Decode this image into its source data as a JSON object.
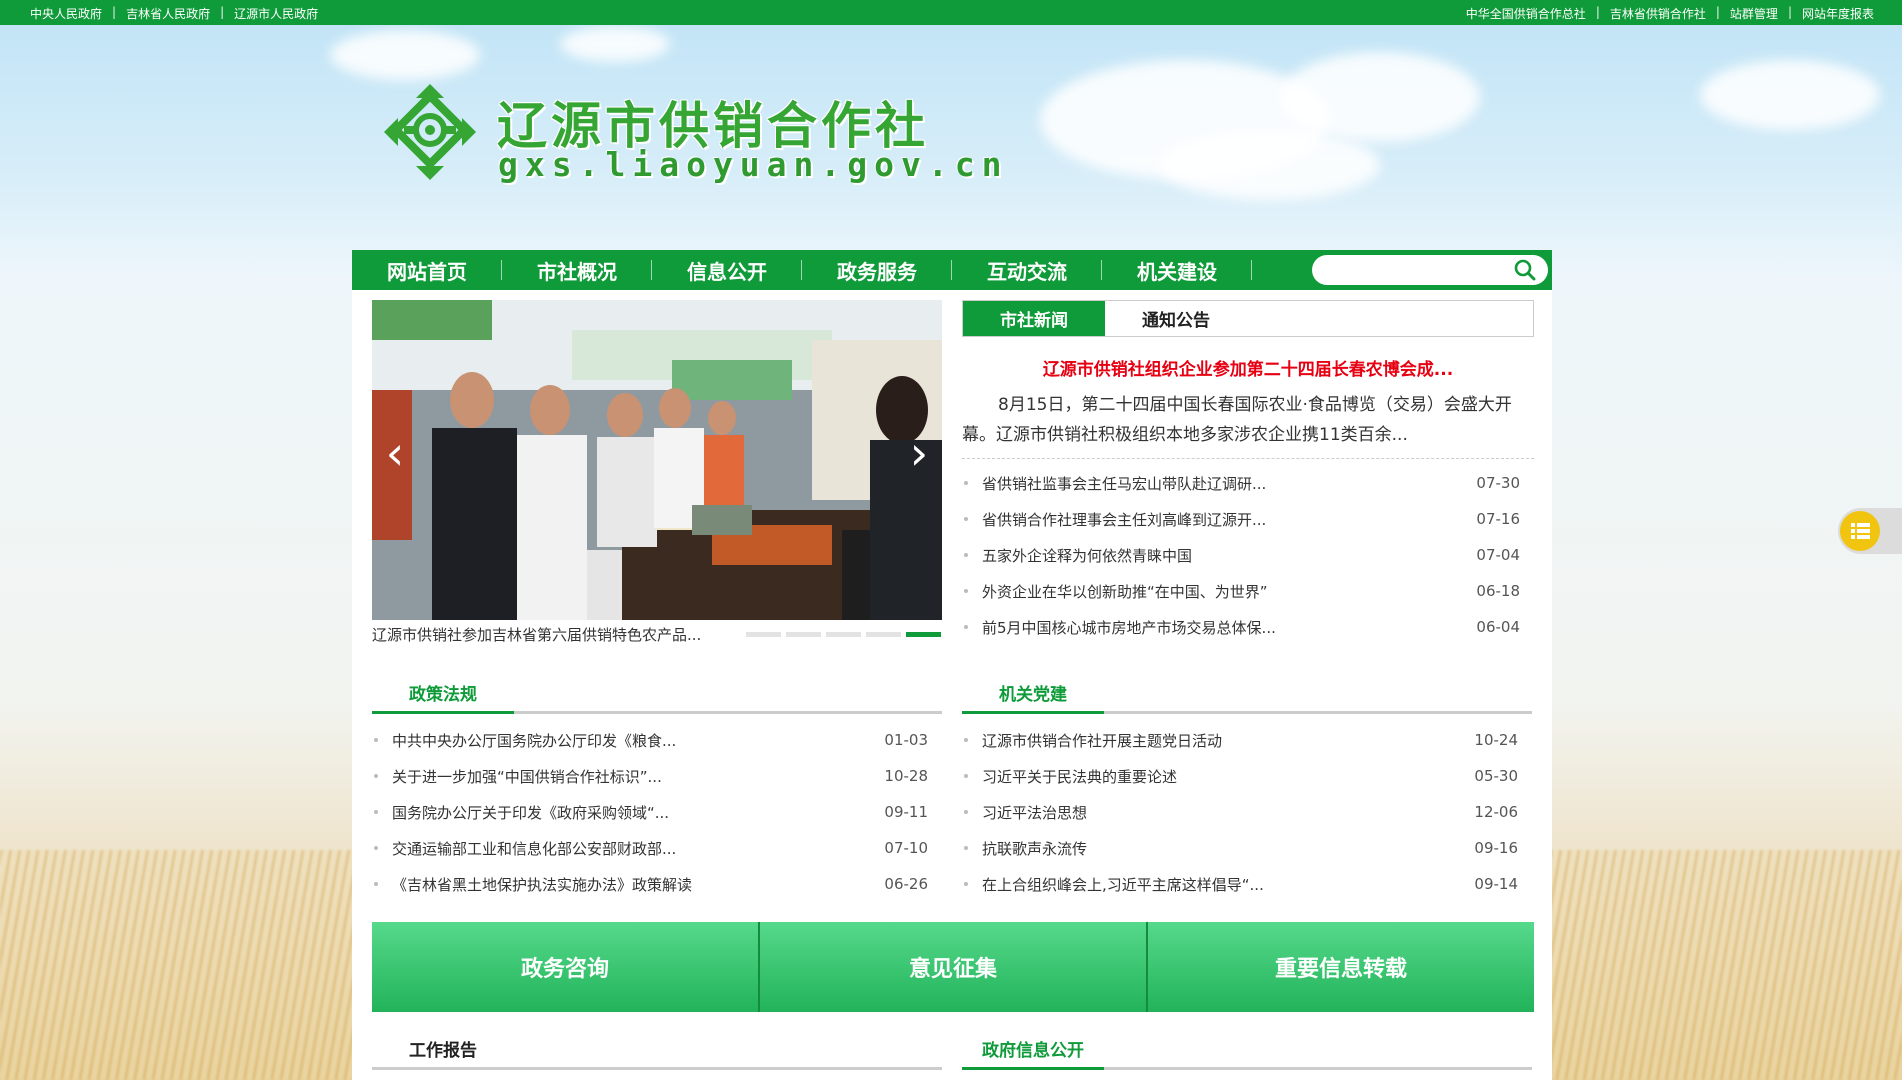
{
  "topbar": {
    "left_links": [
      "中央人民政府",
      "吉林省人民政府",
      "辽源市人民政府"
    ],
    "right_links": [
      "中华全国供销合作总社",
      "吉林省供销合作社",
      "站群管理",
      "网站年度报表"
    ]
  },
  "header": {
    "title": "辽源市供销合作社",
    "url": "gxs.liaoyuan.gov.cn"
  },
  "nav": {
    "items": [
      "网站首页",
      "市社概况",
      "信息公开",
      "政务服务",
      "互动交流",
      "机关建设"
    ],
    "search_placeholder": ""
  },
  "slideshow": {
    "caption": "辽源市供销社参加吉林省第六届供销特色农产品...",
    "prev": "‹",
    "next": "›",
    "slide_count": 5,
    "active_index": 4
  },
  "news": {
    "tabs": [
      "市社新闻",
      "通知公告"
    ],
    "active_tab": 0,
    "headline": "辽源市供销社组织企业参加第二十四届长春农博会成...",
    "summary": "8月15日，第二十四届中国长春国际农业·食品博览（交易）会盛大开幕。辽源市供销社积极组织本地多家涉农企业携11类百余...",
    "items": [
      {
        "title": "省供销社监事会主任马宏山带队赴辽调研...",
        "date": "07-30"
      },
      {
        "title": "省供销合作社理事会主任刘高峰到辽源开...",
        "date": "07-16"
      },
      {
        "title": "五家外企诠释为何依然青睐中国",
        "date": "07-04"
      },
      {
        "title": "外资企业在华以创新助推“在中国、为世界”",
        "date": "06-18"
      },
      {
        "title": "前5月中国核心城市房地产市场交易总体保...",
        "date": "06-04"
      }
    ]
  },
  "policy": {
    "title": "政策法规",
    "items": [
      {
        "title": "中共中央办公厅国务院办公厅印发《粮食...",
        "date": "01-03"
      },
      {
        "title": "关于进一步加强“中国供销合作社标识”...",
        "date": "10-28"
      },
      {
        "title": "国务院办公厅关于印发《政府采购领域“...",
        "date": "09-11"
      },
      {
        "title": "交通运输部工业和信息化部公安部财政部...",
        "date": "07-10"
      },
      {
        "title": "《吉林省黑土地保护执法实施办法》政策解读",
        "date": "06-26"
      }
    ]
  },
  "party": {
    "title": "机关党建",
    "items": [
      {
        "title": "辽源市供销合作社开展主题党日活动",
        "date": "10-24"
      },
      {
        "title": "习近平关于民法典的重要论述",
        "date": "05-30"
      },
      {
        "title": "习近平法治思想",
        "date": "12-06"
      },
      {
        "title": "抗联歌声永流传",
        "date": "09-16"
      },
      {
        "title": "在上合组织峰会上,习近平主席这样倡导“...",
        "date": "09-14"
      }
    ]
  },
  "banner": [
    "政务咨询",
    "意见征集",
    "重要信息转载"
  ],
  "bottom_sections": [
    "工作报告",
    "政府信息公开"
  ],
  "colors": {
    "brand_green": "#0f9b3a",
    "headline_red": "#e60012",
    "banner_green": "#22b35a"
  }
}
